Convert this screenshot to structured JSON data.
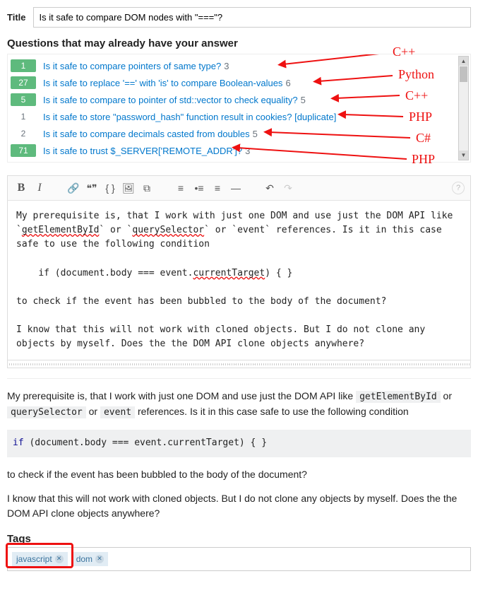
{
  "title_label": "Title",
  "title_value": "Is it safe to compare DOM nodes with \"===\"?",
  "suggest_heading": "Questions that may already have your answer",
  "suggestions": [
    {
      "votes": "1",
      "badge": true,
      "text": "Is it safe to compare pointers of same type?",
      "answers": "3",
      "lang": "C++"
    },
    {
      "votes": "27",
      "badge": true,
      "text": "Is it safe to replace '==' with 'is' to compare Boolean-values",
      "answers": "6",
      "lang": "Python"
    },
    {
      "votes": "5",
      "badge": true,
      "text": "Is it safe to compare to pointer of std::vector to check equality?",
      "answers": "5",
      "lang": "C++"
    },
    {
      "votes": "1",
      "badge": false,
      "text": "Is it safe to store \"password_hash\" function result in cookies? [duplicate]",
      "answers": "",
      "lang": "PHP"
    },
    {
      "votes": "2",
      "badge": false,
      "text": "Is it safe to compare decimals casted from doubles",
      "answers": "5",
      "lang": "C#"
    },
    {
      "votes": "71",
      "badge": true,
      "text": "Is it safe to trust $_SERVER['REMOTE_ADDR']?",
      "answers": "3",
      "lang": "PHP"
    }
  ],
  "toolbar": {
    "bold": "B",
    "italic": "I",
    "link": "🔗",
    "quote": "❝❞",
    "code": "{ }",
    "image": "🖼",
    "snippet": "⧉",
    "ol": "≡",
    "ul": "•≡",
    "heading": "≡",
    "hr": "—",
    "undo": "↶",
    "redo": "↷",
    "help": "?"
  },
  "editor_text_parts": {
    "p1a": "My prerequisite is, that I work with just one DOM and use just the DOM API like `",
    "w1": "getElementById",
    "p1b": "` or `",
    "w2": "querySelector",
    "p1c": "` or `event` references. Is it in this case safe to use the following condition",
    "code_a": "    if (document.body === event.",
    "code_w": "currentTarget",
    "code_b": ") { }",
    "p2": "to check if the event has been bubbled to the body of the document?",
    "p3": "I know that this will not work with cloned objects. But I do not clone any objects by myself. Does the the DOM API clone objects anywhere?"
  },
  "preview": {
    "p1_a": "My prerequisite is, that I work with just one DOM and use just the DOM API like ",
    "c1": "getElementById",
    "p1_b": " or ",
    "c2": "querySelector",
    "p1_c": " or ",
    "c3": "event",
    "p1_d": " references. Is it in this case safe to use the following condition",
    "code": "if (document.body === event.currentTarget) { }",
    "code_kw": "if",
    "code_rest": " (document.body === event.currentTarget) { }",
    "p2": "to check if the event has been bubbled to the body of the document?",
    "p3": "I know that this will not work with cloned objects. But I do not clone any objects by myself. Does the the DOM API clone objects anywhere?"
  },
  "tags_label": "Tags",
  "tags": [
    {
      "name": "javascript"
    },
    {
      "name": "dom"
    }
  ]
}
